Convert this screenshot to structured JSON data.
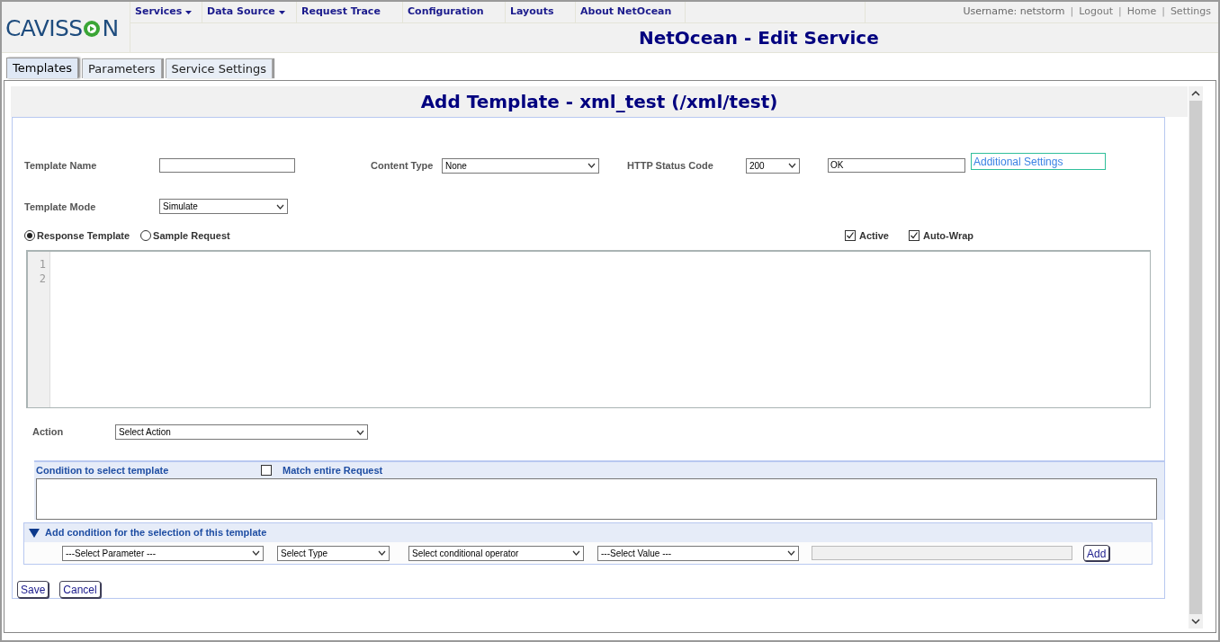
{
  "logo": {
    "left": "CAVISS",
    "right": "N"
  },
  "nav": [
    {
      "label": "Services",
      "has_menu": true
    },
    {
      "label": "Data Source",
      "has_menu": true
    },
    {
      "label": "Request Trace",
      "has_menu": false
    },
    {
      "label": "Configuration",
      "has_menu": false
    },
    {
      "label": "Layouts",
      "has_menu": false
    },
    {
      "label": "About NetOcean",
      "has_menu": false
    }
  ],
  "user_bar": [
    {
      "kind": "text",
      "label": "Username: netstorm"
    },
    {
      "kind": "separator",
      "label": "|"
    },
    {
      "kind": "link",
      "label": "Logout"
    },
    {
      "kind": "separator",
      "label": "|"
    },
    {
      "kind": "link",
      "label": "Home"
    },
    {
      "kind": "separator",
      "label": "|"
    },
    {
      "kind": "link",
      "label": "Settings"
    }
  ],
  "page_title": "NetOcean - Edit Service",
  "tabs": [
    {
      "label": "Templates",
      "selected": true
    },
    {
      "label": "Parameters",
      "selected": false
    },
    {
      "label": "Service Settings",
      "selected": false
    }
  ],
  "form_title": "Add Template - xml_test (/xml/test)",
  "template_name": {
    "label": "Template Name"
  },
  "content_type": {
    "label": "Content Type",
    "value": "None"
  },
  "http_status": {
    "label": "HTTP Status Code",
    "value": "200",
    "reason": "OK"
  },
  "additional_settings": "Additional Settings",
  "template_mode": {
    "label": "Template Mode",
    "value": "Simulate"
  },
  "template_source": [
    {
      "label": "Response Template",
      "selected": true
    },
    {
      "label": "Sample Request",
      "selected": false
    }
  ],
  "options": [
    {
      "label": "Active",
      "checked": true
    },
    {
      "label": "Auto-Wrap",
      "checked": true
    }
  ],
  "editor": {
    "line_numbers": [
      "1",
      "2"
    ]
  },
  "action": {
    "label": "Action",
    "value": "Select Action"
  },
  "condition": {
    "title": "Condition to select template",
    "match": {
      "label": "Match entire Request",
      "checked": false
    }
  },
  "add_condition": {
    "title": "Add condition for the selection of this template",
    "expanded": true,
    "selects": [
      "---Select Parameter ---",
      "Select Type",
      "Select conditional operator",
      "---Select Value ---"
    ],
    "add_button": "Add"
  },
  "buttons": [
    "Save",
    "Cancel"
  ]
}
